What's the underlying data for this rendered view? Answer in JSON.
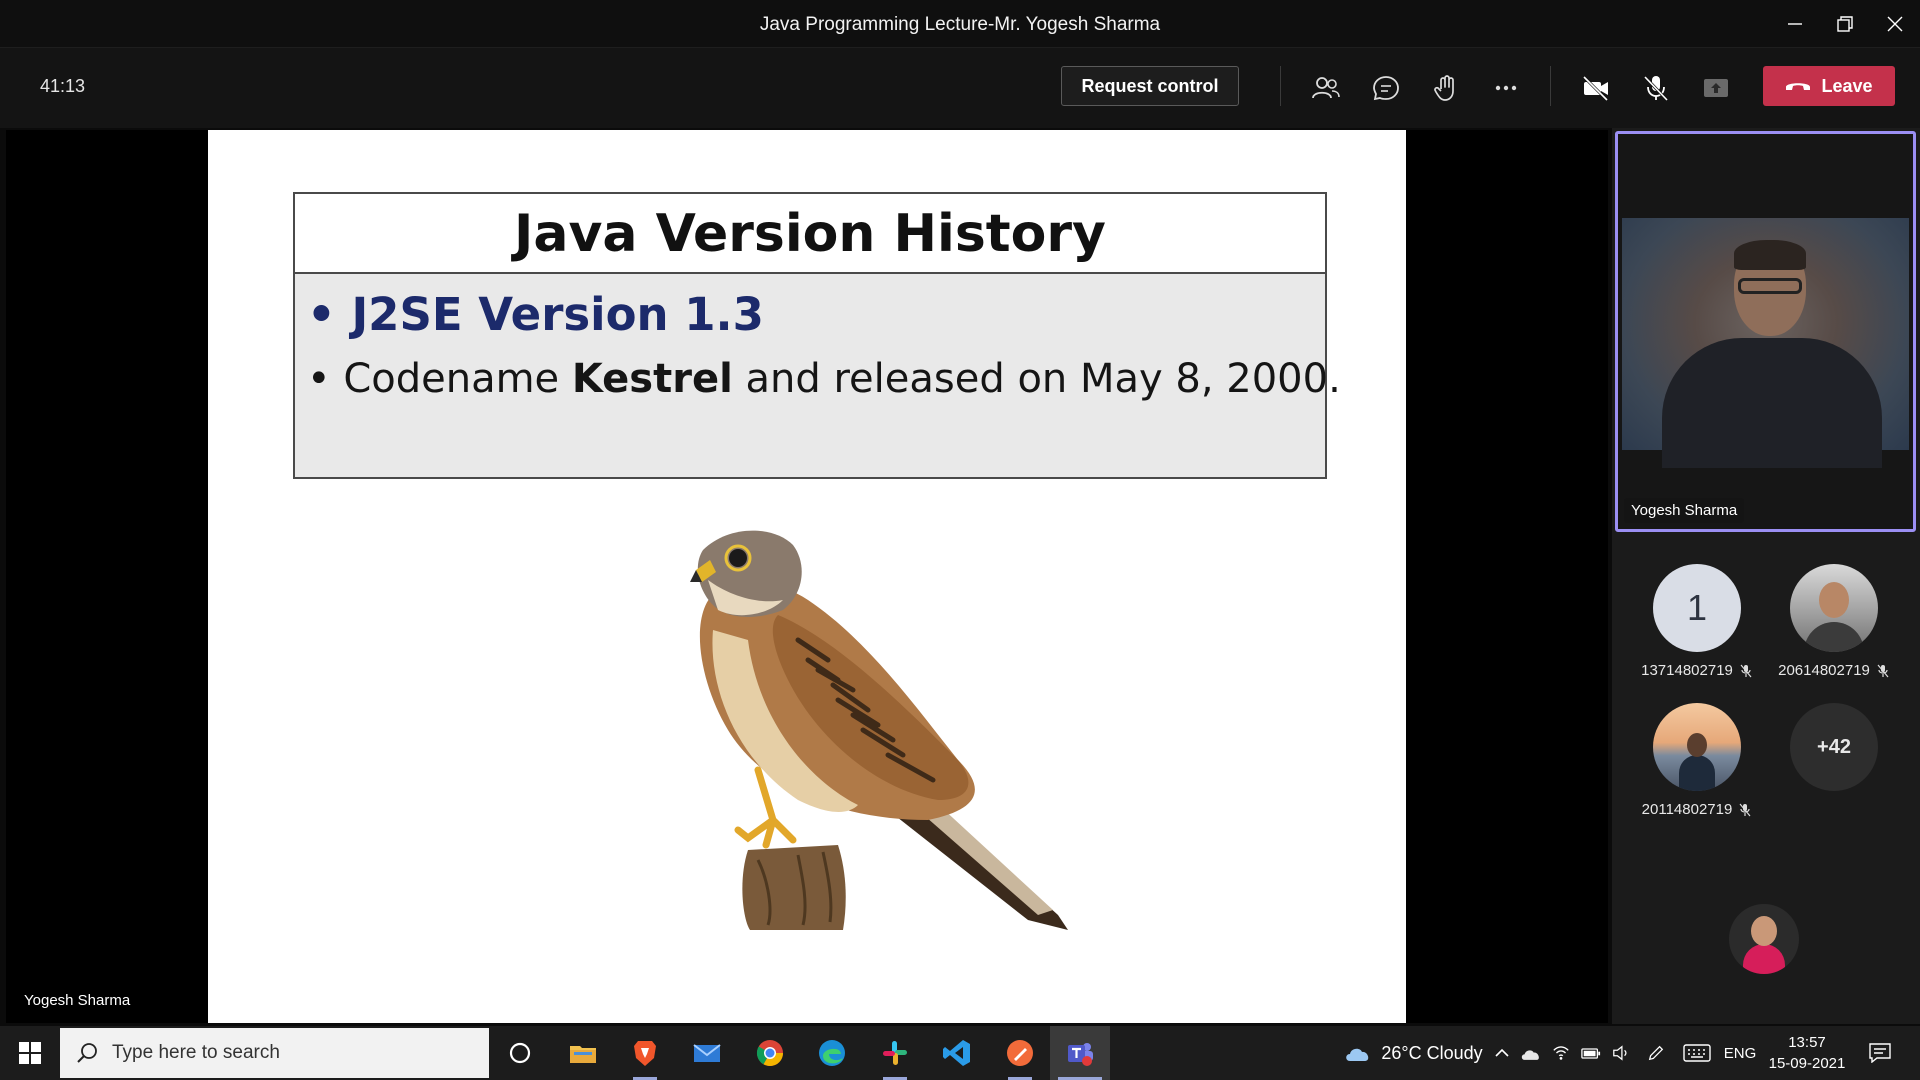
{
  "window": {
    "title": "Java Programming Lecture-Mr. Yogesh Sharma"
  },
  "toolbar": {
    "timer": "41:13",
    "request_control_label": "Request control",
    "leave_label": "Leave"
  },
  "slide": {
    "title": "Java Version History",
    "bullet1": "J2SE Version 1.3",
    "bullet2_prefix": "Codename ",
    "bullet2_bold": "Kestrel",
    "bullet2_suffix": " and released on May 8, 2000."
  },
  "stage": {
    "presenter_name": "Yogesh Sharma"
  },
  "panel": {
    "video_name": "Yogesh Sharma",
    "participants": [
      {
        "id": "13714802719",
        "avatar_text": "1"
      },
      {
        "id": "20614802719"
      },
      {
        "id": "20114802719"
      }
    ],
    "overflow_count": "+42"
  },
  "taskbar": {
    "search_placeholder": "Type here to search",
    "weather": "26°C  Cloudy",
    "language": "ENG",
    "time": "13:57",
    "date": "15-09-2021"
  },
  "colors": {
    "leave": "#c4314b",
    "active_border": "#9b8ff3",
    "slide_bullet": "#1c2a6b"
  }
}
